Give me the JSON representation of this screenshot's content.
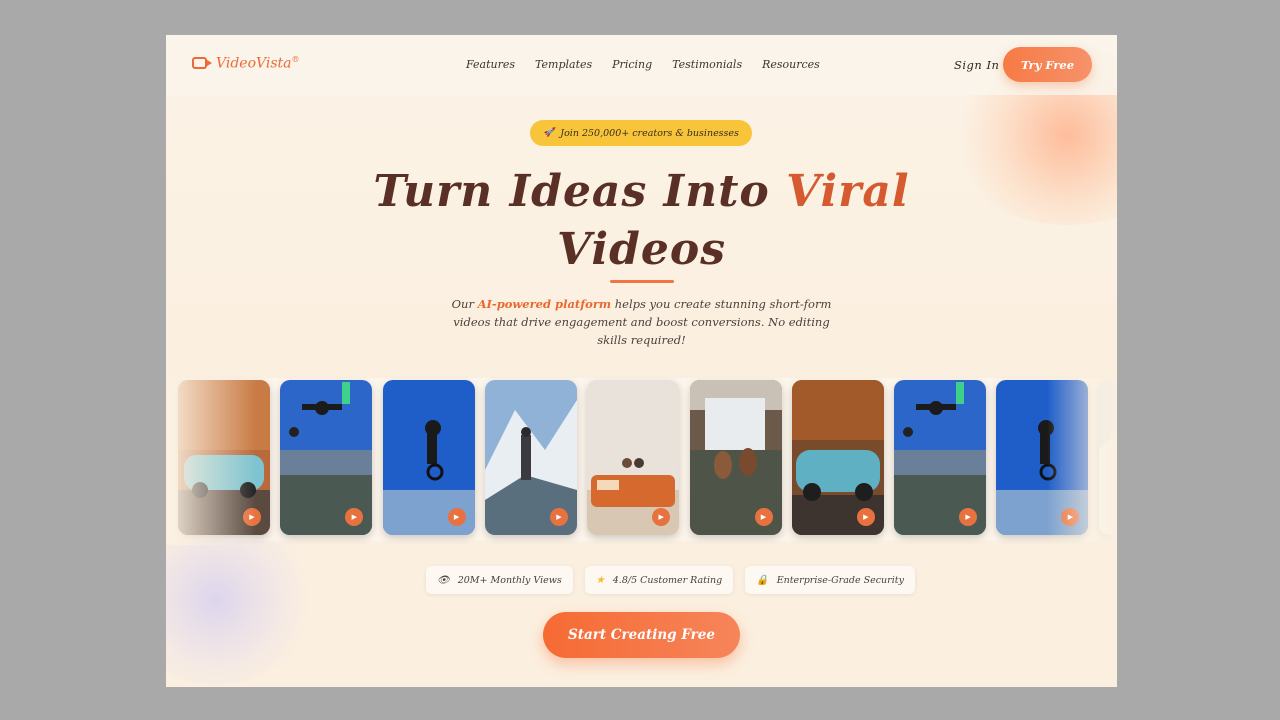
{
  "brand": {
    "name": "VideoVista",
    "mark": "®"
  },
  "nav": {
    "items": [
      "Features",
      "Templates",
      "Pricing",
      "Testimonials",
      "Resources"
    ],
    "sign_in": "Sign In",
    "try_free": "Try Free"
  },
  "hero": {
    "badge_icon": "rocket-icon",
    "badge": "Join 250,000+ creators & businesses",
    "title_part1": "Turn Ideas Into ",
    "title_highlight": "Viral",
    "title_part2": "Videos",
    "subtitle_pre": "Our ",
    "subtitle_accent": "AI-powered platform",
    "subtitle_post": " helps you create stunning short-form videos that drive engagement and boost conversions. No editing skills required!"
  },
  "videos": [
    {
      "scene": "car"
    },
    {
      "scene": "skydive"
    },
    {
      "scene": "bike"
    },
    {
      "scene": "mountain"
    },
    {
      "scene": "van"
    },
    {
      "scene": "waterfall"
    },
    {
      "scene": "car2"
    },
    {
      "scene": "skydive"
    },
    {
      "scene": "bike"
    },
    {
      "scene": "snow"
    }
  ],
  "stats": [
    {
      "icon": "eye-icon",
      "label": "20M+ Monthly Views"
    },
    {
      "icon": "star-icon",
      "label": "4.8/5 Customer Rating"
    },
    {
      "icon": "lock-icon",
      "label": "Enterprise-Grade Security"
    }
  ],
  "cta": "Start Creating Free",
  "colors": {
    "accent": "#ef7640",
    "badge": "#f8c53a",
    "title": "#5a2f26"
  }
}
